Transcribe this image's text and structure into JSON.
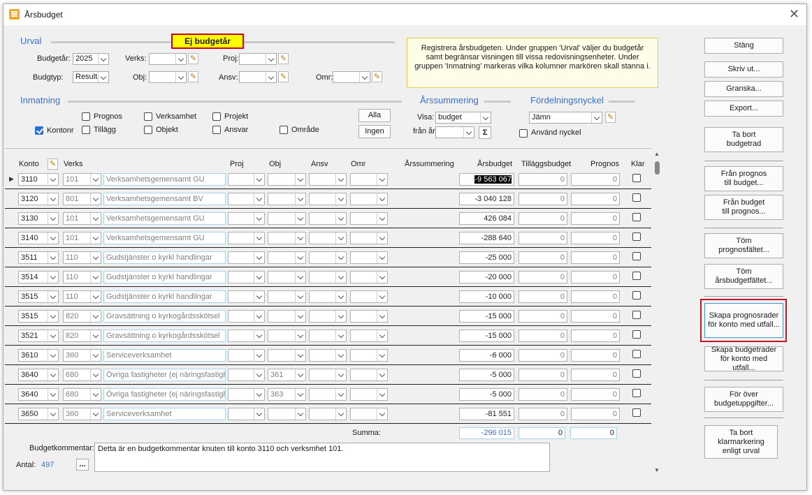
{
  "window": {
    "title": "Årsbudget"
  },
  "badge": "Ej budgetår",
  "urval": {
    "section": "Urval",
    "budgetar_label": "Budgetår:",
    "budgetar_value": "2025",
    "budgtyp_label": "Budgtyp:",
    "budgtyp_value": "Resultat",
    "verks_label": "Verks:",
    "obj_label": "Obj:",
    "proj_label": "Proj:",
    "ansv_label": "Ansv:",
    "omr_label": "Omr:"
  },
  "info_text": "Registrera årsbudgeten. Under gruppen 'Urval' väljer du budgetår samt begränsar visningen till vissa redovisningsenheter. Under gruppen 'Inmatning' markeras vilka kolumner markören skall stanna i.",
  "inmatning": {
    "section": "Inmatning",
    "options": {
      "prognos": "Prognos",
      "verksamhet": "Verksamhet",
      "projekt": "Projekt",
      "kontonr": "Kontonr",
      "tillagg": "Tillägg",
      "objekt": "Objekt",
      "ansvar": "Ansvar",
      "omrade": "Område"
    },
    "alla": "Alla",
    "ingen": "Ingen"
  },
  "arssummering": {
    "section": "Årssummering",
    "visa_label": "Visa:",
    "visa_value": "budget",
    "fran_ar_label": "från år",
    "sigma": "Σ"
  },
  "fordelning": {
    "section": "Fördelningsnyckel",
    "value": "Jämn",
    "use_label": "Använd nyckel"
  },
  "columns": {
    "konto": "Konto",
    "verks": "Verks",
    "proj": "Proj",
    "obj": "Obj",
    "ansv": "Ansv",
    "omr": "Omr",
    "arssummering": "Årssummering",
    "arsbudget": "Årsbudget",
    "tillaggsbudget": "Tilläggsbudget",
    "prognos": "Prognos",
    "klar": "Klar"
  },
  "rows": [
    {
      "konto": "3110",
      "verks": "101",
      "name": "Verksamhetsgemensamt GU",
      "obj": "",
      "budget": "-9 563 067",
      "tillagg": "0",
      "prognos": "0"
    },
    {
      "konto": "3120",
      "verks": "801",
      "name": "Verksamhetsgemensamt BV",
      "obj": "",
      "budget": "-3 040 128",
      "tillagg": "0",
      "prognos": "0"
    },
    {
      "konto": "3130",
      "verks": "101",
      "name": "Verksamhetsgemensamt GU",
      "obj": "",
      "budget": "426 084",
      "tillagg": "0",
      "prognos": "0"
    },
    {
      "konto": "3140",
      "verks": "101",
      "name": "Verksamhetsgemensamt GU",
      "obj": "",
      "budget": "-288 640",
      "tillagg": "0",
      "prognos": "0"
    },
    {
      "konto": "3511",
      "verks": "110",
      "name": "Gudstjänster o kyrkl handlingar",
      "obj": "",
      "budget": "-25 000",
      "tillagg": "0",
      "prognos": "0"
    },
    {
      "konto": "3514",
      "verks": "110",
      "name": "Gudstjänster o kyrkl handlingar",
      "obj": "",
      "budget": "-20 000",
      "tillagg": "0",
      "prognos": "0"
    },
    {
      "konto": "3515",
      "verks": "110",
      "name": "Gudstjänster o kyrkl handlingar",
      "obj": "",
      "budget": "-10 000",
      "tillagg": "0",
      "prognos": "0"
    },
    {
      "konto": "3515",
      "verks": "820",
      "name": "Gravsättning o kyrkogårdsskötsel",
      "obj": "",
      "budget": "-15 000",
      "tillagg": "0",
      "prognos": "0"
    },
    {
      "konto": "3521",
      "verks": "820",
      "name": "Gravsättning o kyrkogårdsskötsel",
      "obj": "",
      "budget": "-15 000",
      "tillagg": "0",
      "prognos": "0"
    },
    {
      "konto": "3610",
      "verks": "360",
      "name": "Serviceverksamhet",
      "obj": "",
      "budget": "-6 000",
      "tillagg": "0",
      "prognos": "0"
    },
    {
      "konto": "3640",
      "verks": "680",
      "name": "Övriga fastigheter (ej näringsfastighe",
      "obj": "361",
      "budget": "-5 000",
      "tillagg": "0",
      "prognos": "0"
    },
    {
      "konto": "3640",
      "verks": "680",
      "name": "Övriga fastigheter (ej näringsfastighe",
      "obj": "363",
      "budget": "-5 000",
      "tillagg": "0",
      "prognos": "0"
    },
    {
      "konto": "3650",
      "verks": "360",
      "name": "Serviceverksamhet",
      "obj": "",
      "budget": "-81 551",
      "tillagg": "0",
      "prognos": "0"
    }
  ],
  "summa": {
    "label": "Summa:",
    "budget": "-296 015",
    "tillagg": "0",
    "prognos": "0"
  },
  "kommentar": {
    "label": "Budgetkommentar:",
    "text": "Detta är en budgetkommentar knuten till konto 3110 och verksmhet 101."
  },
  "antal": {
    "label": "Antal:",
    "value": "497",
    "more": "..."
  },
  "buttons": {
    "stang": "Stäng",
    "skriv_ut": "Skriv ut...",
    "granska": "Granska...",
    "export": "Export...",
    "ta_bort_budgetrad": "Ta bort budgetrad",
    "fran_prognos": "Från prognos till budget...",
    "fran_budget": "Från budget till prognos...",
    "tom_prognos": "Töm prognosfältet...",
    "tom_arsbudget": "Töm årsbudgetfältet...",
    "skapa_prognos": "Skapa prognosrader för konto med utfall...",
    "skapa_budget": "Skapa budgetrader för konto med utfall...",
    "for_over": "För över budgetuppgifter...",
    "ta_bort_klar": "Ta bort klarmarkering enligt urval"
  },
  "colors": {
    "accent": "#3a6fc4",
    "badge_bg": "#ffff00",
    "highlight_border": "#c4162a"
  }
}
